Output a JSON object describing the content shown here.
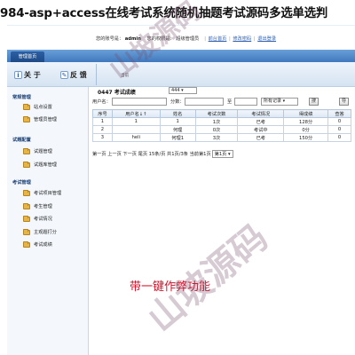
{
  "banner": {
    "title": "984-asp+access在线考试系统随机抽题考试源码多选单选判"
  },
  "header": {
    "account_label": "您的账号是：",
    "account_value": "admin",
    "role_label": "您的权限是：",
    "role_value": "超级管理员",
    "link_home": "前台首页",
    "link_password": "修改密码",
    "link_logout": "退出登录",
    "separator": "|"
  },
  "nav": {
    "tab_home": "管理首页"
  },
  "toolbar": {
    "about_label": "关 于",
    "feedback_label": "反 馈",
    "breadcrumb": "当前"
  },
  "sidebar": {
    "groups": [
      {
        "title": "常规管理",
        "items": [
          "站点设置",
          "管理员管理"
        ]
      },
      {
        "title": "试题配置",
        "items": [
          "试题管理",
          "试题库管理"
        ]
      },
      {
        "title": "考试管理",
        "items": [
          "考试项目管理",
          "考生管理",
          "考试情况",
          "主观题打分",
          "考试成绩"
        ]
      }
    ]
  },
  "main": {
    "title": "0447 考试成绩",
    "exam_select": "444",
    "filters": {
      "user_label": "用户名：",
      "score_label": "分数：",
      "to_label": "至",
      "record_select": "所有记录",
      "search_button": "搜",
      "more_button": "导"
    },
    "table": {
      "headers": [
        "序号",
        "用户名↓↑",
        "姓名",
        "考试次数",
        "考试情况",
        "得成绩",
        "查答"
      ],
      "rows": [
        [
          "1",
          "1",
          "1",
          "1次",
          "已考",
          "128分",
          "0"
        ],
        [
          "2",
          "",
          "何理",
          "0次",
          "考试中",
          "0分",
          "0"
        ],
        [
          "3",
          "heli",
          "何理1",
          "3次",
          "已考",
          "150分",
          "0"
        ]
      ],
      "status_classes": [
        "st-done",
        "st-doing",
        "st-done"
      ]
    },
    "pager": {
      "text": "第一页 上一页 下一页 尾页 15条/页 共1页/3条 当前第1页",
      "page_select": "第1页"
    }
  },
  "promo": {
    "text": "带一键作弊功能"
  },
  "watermark": {
    "text": "山坡源码"
  },
  "colors": {
    "nav_blue": "#3f78be",
    "promo_red": "#d8102a",
    "status_green": "#10a020",
    "status_blue": "#1a3fd0"
  }
}
